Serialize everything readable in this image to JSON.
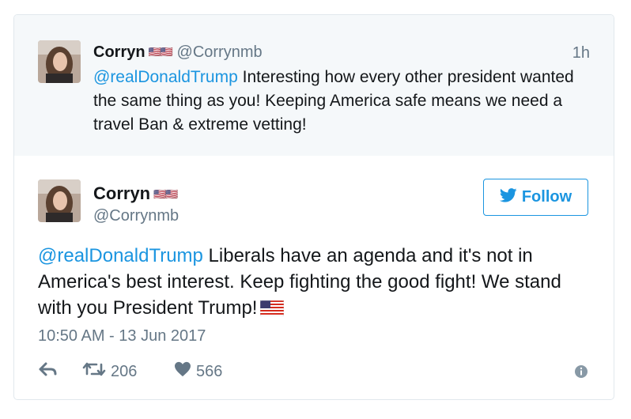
{
  "parent_tweet": {
    "name": "Corryn",
    "flags": "🇺🇸🇺🇸",
    "handle": "@Corrynmb",
    "time": "1h",
    "mention": "@realDonaldTrump",
    "text": " Interesting how every other president wanted the same thing as you! Keeping America safe means we need a travel Ban & extreme vetting!"
  },
  "main_tweet": {
    "name": "Corryn",
    "flags": "🇺🇸🇺🇸",
    "handle": "@Corrynmb",
    "follow_label": "Follow",
    "mention": "@realDonaldTrump",
    "text": " Liberals have an agenda and it's not in America's best interest. Keep fighting the good fight! We stand with you President Trump!",
    "timestamp": "10:50 AM - 13 Jun 2017",
    "retweets": "206",
    "likes": "566"
  },
  "icons": [
    "reply-icon",
    "retweet-icon",
    "heart-icon",
    "info-icon",
    "twitter-bird-icon",
    "us-flag-icon"
  ],
  "colors": {
    "accent": "#1b95e0",
    "muted": "#657786",
    "parent_bg": "#f5f8fa"
  }
}
